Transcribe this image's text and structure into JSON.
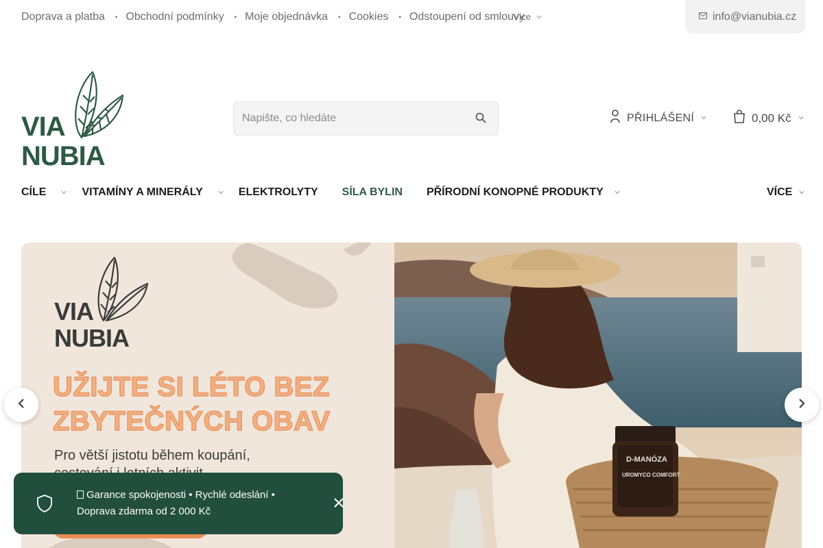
{
  "topbar": {
    "links": [
      "Doprava a platba",
      "Obchodní podmínky",
      "Moje objednávka",
      "Cookies",
      "Odstoupení od smlouvy"
    ],
    "more_label": "Více",
    "email": "info@vianubia.cz"
  },
  "header": {
    "logo_line1": "VIA",
    "logo_line2": "NUBIA",
    "search_placeholder": "Napište, co hledáte",
    "login_label": "PŘIHLÁŠENÍ",
    "cart_total": "0,00 Kč"
  },
  "nav": {
    "items": [
      "CÍLE",
      "VITAMÍNY A MINERÁLY",
      "ELEKTROLYTY",
      "SÍLA BYLIN",
      "PŘÍRODNÍ KONOPNÉ PRODUKTY"
    ],
    "more_label": "VÍCE"
  },
  "banner": {
    "logo_line1": "VIA",
    "logo_line2": "NUBIA",
    "headline_line1": "UŽIJTE SI LÉTO BEZ",
    "headline_line2": "ZBYTEČNÝCH OBAV",
    "sub_line1": "Pro větší jistotu během koupání,",
    "sub_line2": "cestování i letních aktivit",
    "product_label_1": "D-MANÓZA",
    "product_label_2": "UROMYCO COMFORT"
  },
  "toast": {
    "line1": "Garance spokojenosti • Rychlé odeslání •",
    "line2": "Doprava zdarma od 2 000 Kč"
  },
  "colors": {
    "brand_green": "#224e3d",
    "accent_orange": "#ea8c56",
    "banner_bg": "#f1e6dc"
  }
}
